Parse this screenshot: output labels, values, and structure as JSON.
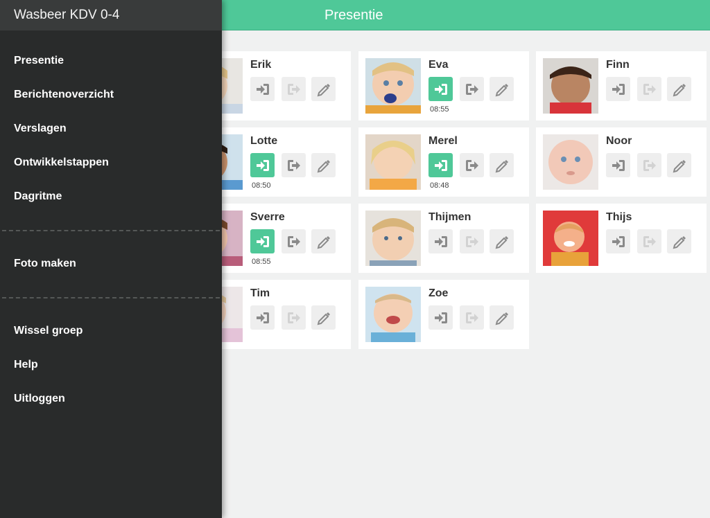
{
  "header": {
    "title": "Presentie"
  },
  "sidebar": {
    "group_name": "Wasbeer KDV 0-4",
    "items": [
      {
        "label": "Presentie"
      },
      {
        "label": "Berichtenoverzicht"
      },
      {
        "label": "Verslagen"
      },
      {
        "label": "Ontwikkelstappen"
      },
      {
        "label": "Dagritme"
      },
      {
        "label": "Foto maken"
      },
      {
        "label": "Wissel groep"
      },
      {
        "label": "Help"
      },
      {
        "label": "Uitloggen"
      }
    ]
  },
  "colors": {
    "accent": "#4fc898",
    "sidebar": "#292b2b",
    "sidebar_header": "#393b3b"
  },
  "children": [
    {
      "name": "Erik",
      "checked_in": false,
      "time": ""
    },
    {
      "name": "Eva",
      "checked_in": true,
      "time": "08:55"
    },
    {
      "name": "Finn",
      "checked_in": false,
      "time": ""
    },
    {
      "name": "Lotte",
      "checked_in": true,
      "time": "08:50"
    },
    {
      "name": "Merel",
      "checked_in": true,
      "time": "08:48"
    },
    {
      "name": "Noor",
      "checked_in": false,
      "time": ""
    },
    {
      "name": "Sverre",
      "checked_in": true,
      "time": "08:55"
    },
    {
      "name": "Thijmen",
      "checked_in": false,
      "time": ""
    },
    {
      "name": "Thijs",
      "checked_in": false,
      "time": ""
    },
    {
      "name": "Tim",
      "checked_in": false,
      "time": ""
    },
    {
      "name": "Zoe",
      "checked_in": false,
      "time": ""
    }
  ],
  "icons": {
    "check_in": "sign-in-icon",
    "check_out": "sign-out-icon",
    "edit": "pencil-icon"
  }
}
